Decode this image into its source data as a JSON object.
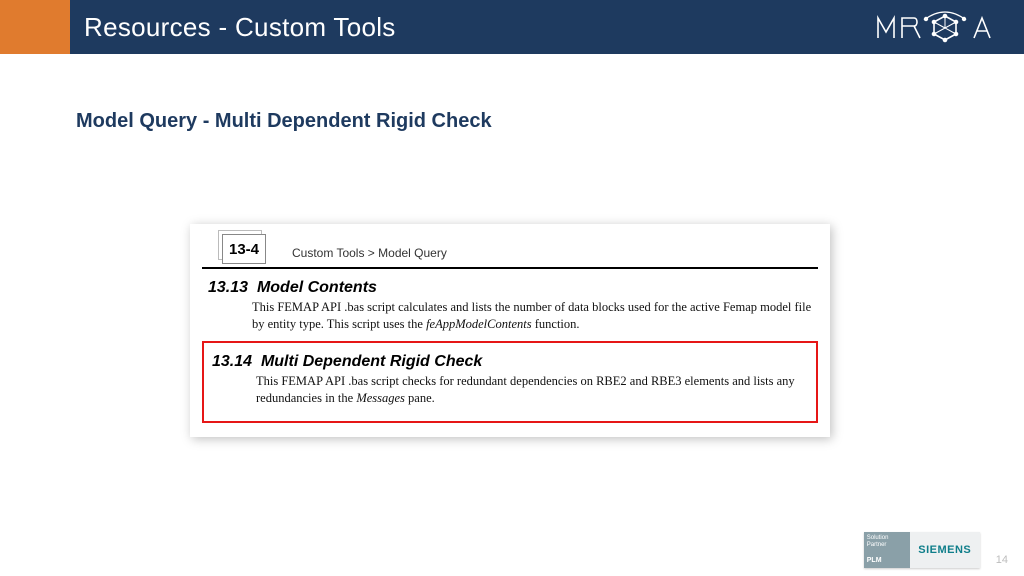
{
  "header": {
    "title": "Resources - Custom Tools",
    "logo_text": "MAYA"
  },
  "subtitle": "Model Query - Multi Dependent Rigid Check",
  "excerpt": {
    "page_tab": "13-4",
    "breadcrumb": "Custom Tools > Model Query",
    "section1": {
      "num": "13.13",
      "title": "Model Contents",
      "body_pre": "This FEMAP API .bas script calculates and lists the number of data blocks used for the active Femap model file by entity type. This script uses the ",
      "body_fn": "feAppModelContents",
      "body_post": " function."
    },
    "section2": {
      "num": "13.14",
      "title": "Multi Dependent Rigid Check",
      "body_pre": "This FEMAP API .bas script checks for redundant dependencies on RBE2 and RBE3 elements and lists any redundancies in the ",
      "body_fn": "Messages",
      "body_post": " pane."
    }
  },
  "footer": {
    "badge_top": "Solution Partner",
    "badge_plm": "PLM",
    "siemens": "SIEMENS",
    "page_number": "14"
  }
}
